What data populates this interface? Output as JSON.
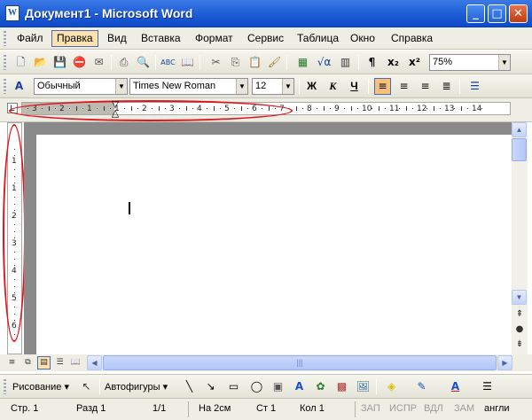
{
  "window": {
    "title": "Документ1 - Microsoft Word",
    "app_icon": "W",
    "buttons": {
      "minimize": "_",
      "maximize": "□",
      "close": "✕"
    }
  },
  "menu": {
    "items": [
      "Файл",
      "Правка",
      "Вид",
      "Вставка",
      "Формат",
      "Сервис",
      "Таблица",
      "Окно",
      "Справка"
    ],
    "active": "Правка"
  },
  "standard_toolbar": {
    "zoom": "75%"
  },
  "formatting_toolbar": {
    "style": "Обычный",
    "font": "Times New Roman",
    "size": "12",
    "bold": "Ж",
    "italic": "К",
    "underline": "Ч"
  },
  "hruler": {
    "labels": [
      "3",
      "2",
      "1",
      "1",
      "2",
      "3",
      "4",
      "5",
      "6",
      "7",
      "8",
      "9",
      "10",
      "11",
      "12",
      "13",
      "14"
    ]
  },
  "vruler": {
    "labels": [
      "1",
      "1",
      "2",
      "3",
      "4",
      "5",
      "6"
    ]
  },
  "drawing_toolbar": {
    "draw": "Рисование ▾",
    "autoshapes": "Автофигуры ▾"
  },
  "status": {
    "page": "Стр. 1",
    "section": "Разд 1",
    "pages": "1/1",
    "at": "На 2см",
    "line": "Ст 1",
    "col": "Кол 1",
    "rec": "ЗАП",
    "trk": "ИСПР",
    "ext": "ВДЛ",
    "ovr": "ЗАМ",
    "lang": "англи"
  },
  "colors": {
    "title_bar": "#1f5fd6",
    "highlight": "#e0141e",
    "menu_bg": "#eeeee5"
  }
}
